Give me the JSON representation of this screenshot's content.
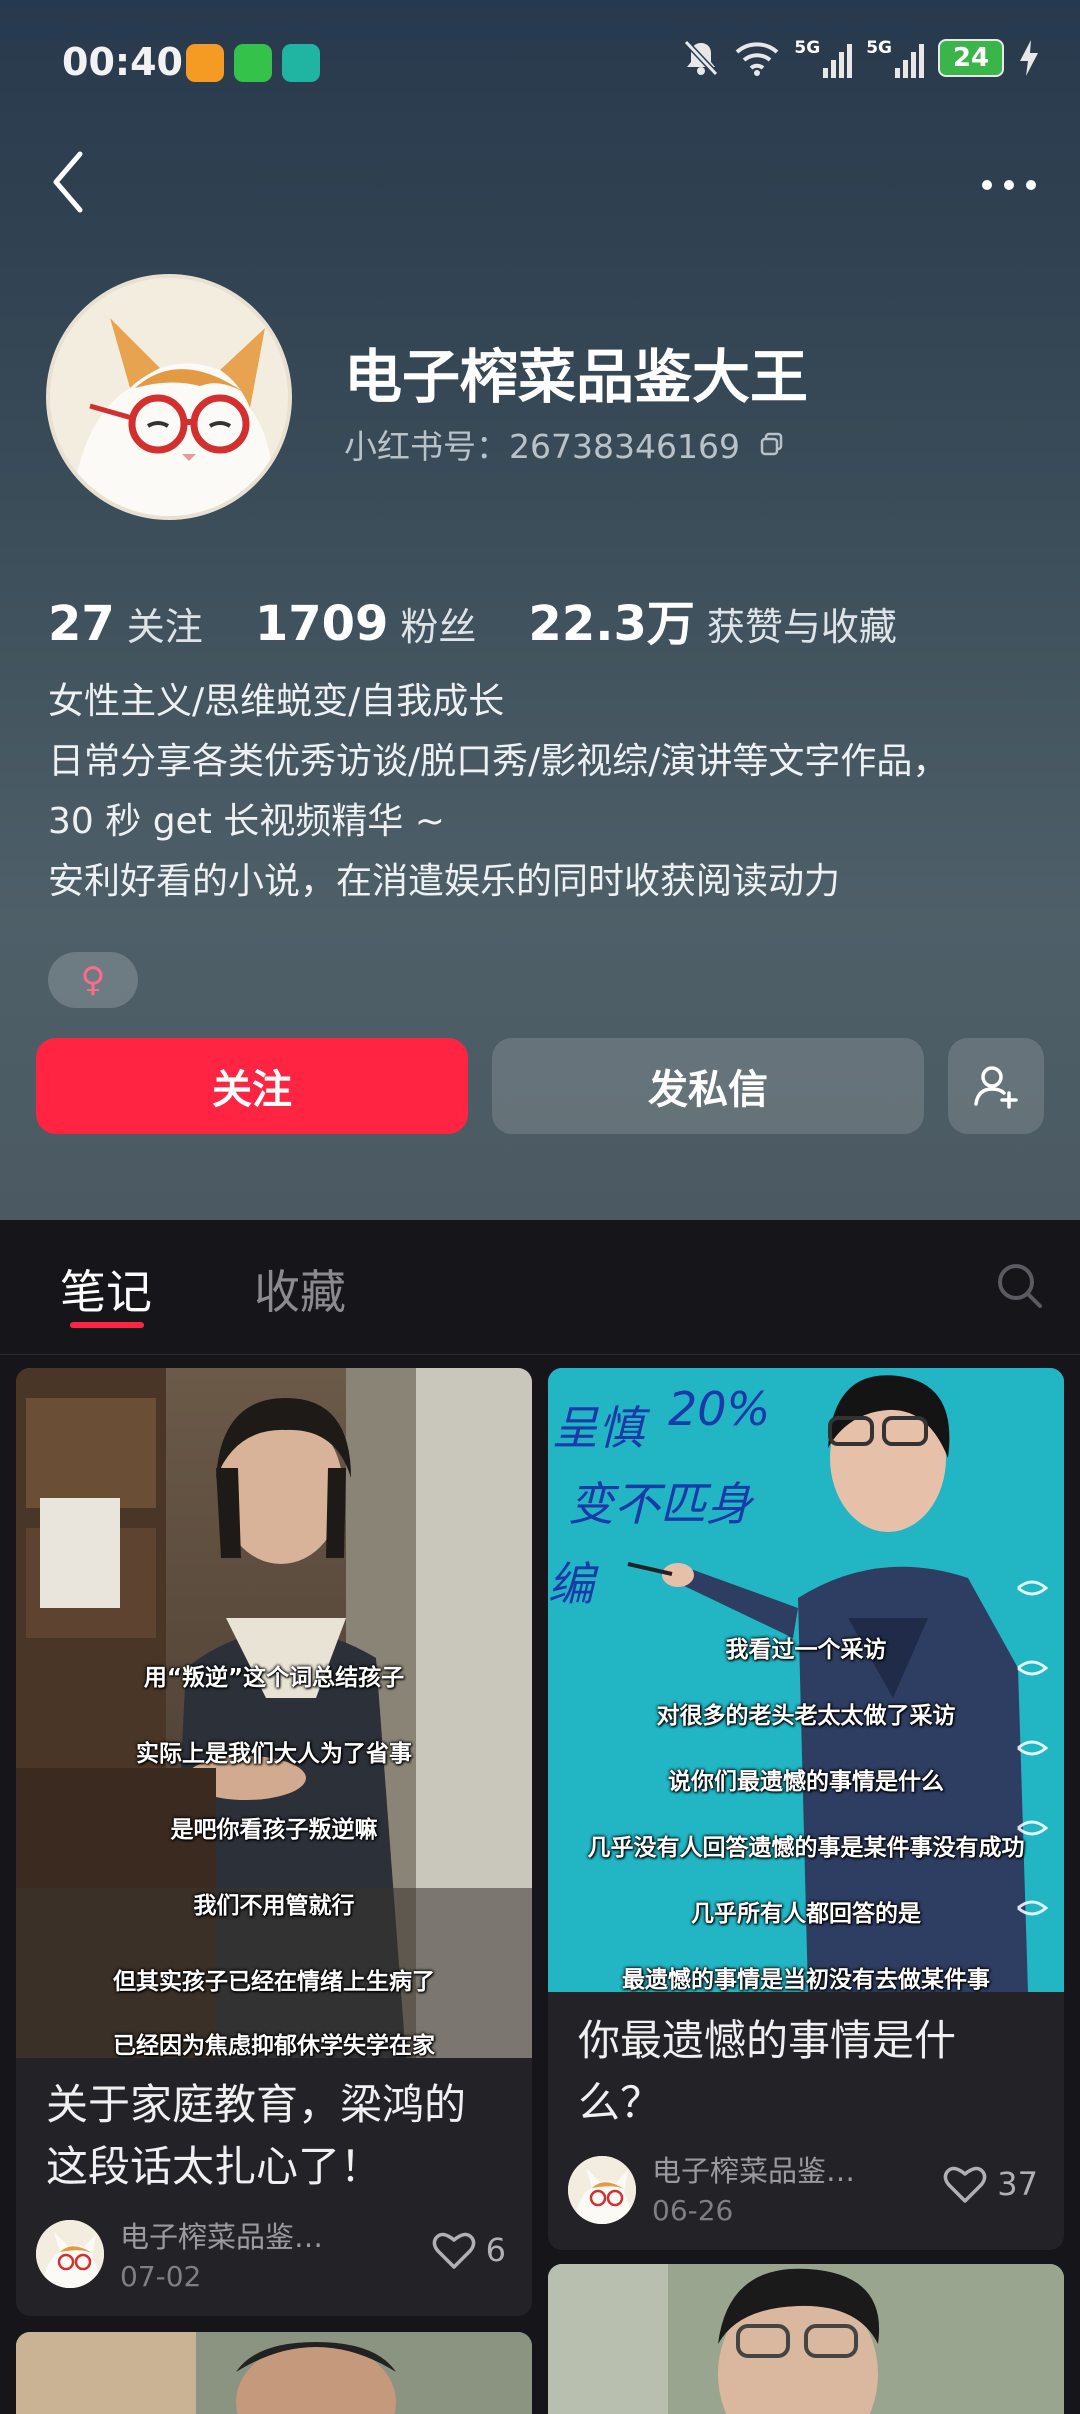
{
  "status_bar": {
    "time": "00:40",
    "signal_1": "5G",
    "signal_2": "5G",
    "battery": "24"
  },
  "profile": {
    "name": "电子榨菜品鉴大王",
    "red_id": "小红书号：26738346169",
    "stats": [
      {
        "value": "27",
        "label": "关注"
      },
      {
        "value": "1709",
        "label": "粉丝"
      },
      {
        "value": "22.3万",
        "label": "获赞与收藏"
      }
    ],
    "bio": [
      "女性主义/思维蜕变/自我成长",
      "日常分享各类优秀访谈/脱口秀/影视综/演讲等文字作品，",
      "30 秒 get 长视频精华 ~",
      "安利好看的小说，在消遣娱乐的同时收获阅读动力"
    ],
    "gender_symbol": "♀"
  },
  "actions": {
    "follow": "关注",
    "message": "发私信"
  },
  "tabs": {
    "notes": "笔记",
    "favorites": "收藏"
  },
  "notes": [
    {
      "captions": [
        "用“叛逆”这个词总结孩子",
        "实际上是我们大人为了省事",
        "是吧你看孩子叛逆嘛",
        "我们不用管就行",
        "但其实孩子已经在情绪上生病了",
        "已经因为焦虑抑郁休学失学在家"
      ],
      "title": "关于家庭教育，梁鸿的这段话太扎心了！",
      "author": "电子榨菜品鉴…",
      "date": "07-02",
      "likes": "6"
    },
    {
      "board_text": [
        "呈慎",
        "20%",
        "变不匹身",
        "编"
      ],
      "captions": [
        "我看过一个采访",
        "对很多的老头老太太做了采访",
        "说你们最遗憾的事情是什么",
        "几乎没有人回答遗憾的事是某件事没有成功",
        "几乎所有人都回答的是",
        "最遗憾的事情是当初没有去做某件事"
      ],
      "title": "你最遗憾的事情是什么？",
      "author": "电子榨菜品鉴…",
      "date": "06-26",
      "likes": "37"
    }
  ],
  "colors": {
    "accent": "#ff2442",
    "background": "#16161a",
    "card": "#222227"
  }
}
